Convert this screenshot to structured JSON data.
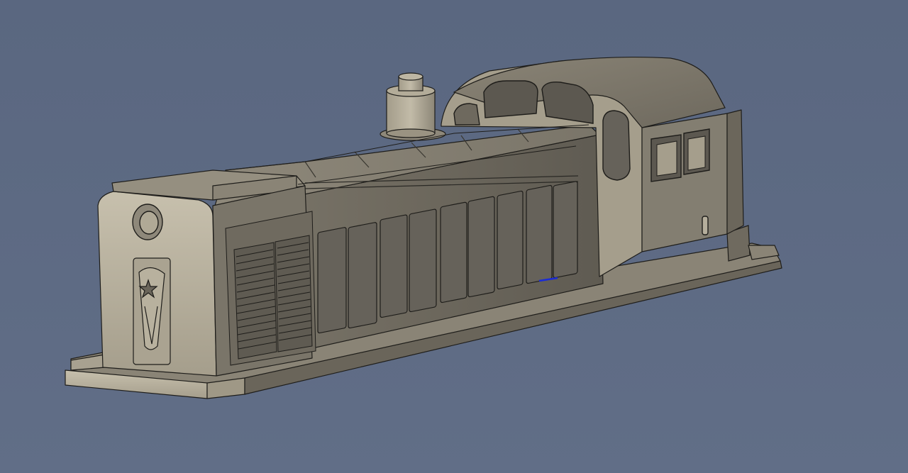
{
  "viewport": {
    "background_color": "#5d6a82",
    "model_fill_light": "#b5ae9c",
    "model_fill_mid": "#8e887a",
    "model_fill_dark": "#5c5850",
    "edge_color": "#1e1d1a",
    "selection_color": "#1a2bd6"
  },
  "model": {
    "kind": "3D CAD model of a diesel switcher locomotive body",
    "parts": [
      "short-hood",
      "headlight",
      "star-emblem",
      "front-louvers",
      "long-hood-doors",
      "exhaust-stack",
      "roof-panels",
      "cab",
      "cab-windows",
      "cab-roof",
      "deck-frame",
      "rear-step"
    ]
  }
}
